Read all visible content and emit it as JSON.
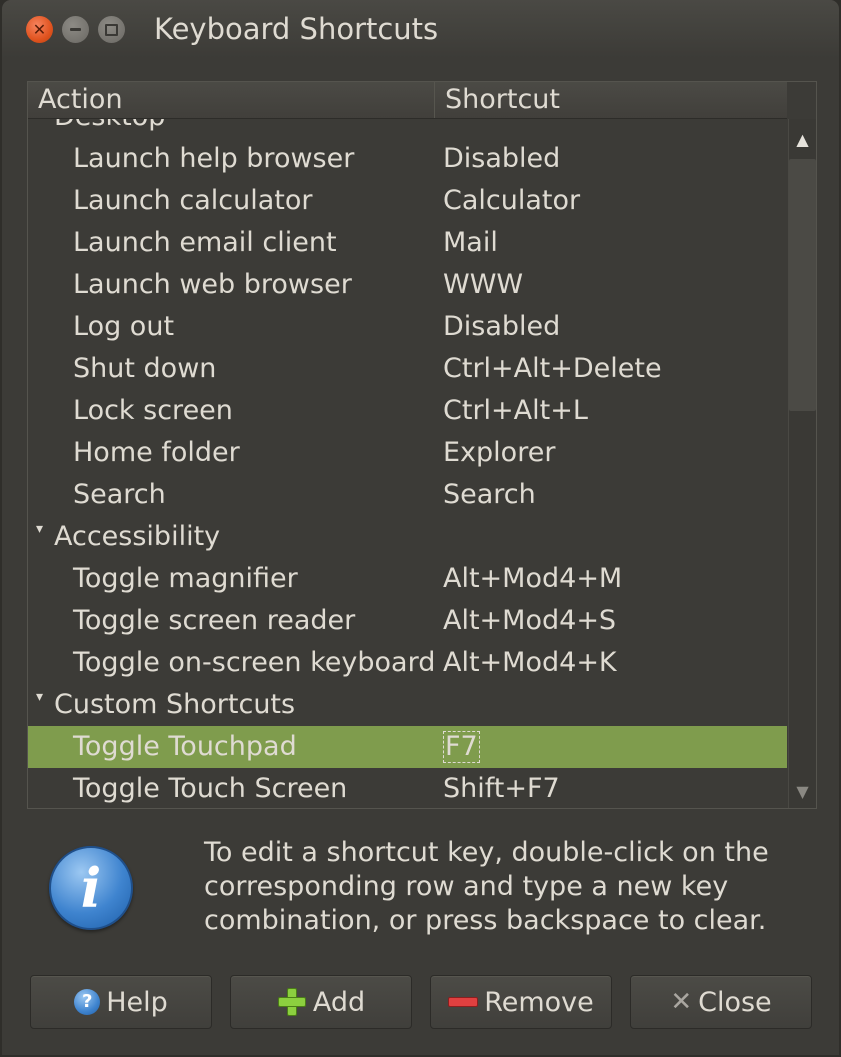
{
  "window": {
    "title": "Keyboard Shortcuts"
  },
  "columns": {
    "action": "Action",
    "shortcut": "Shortcut"
  },
  "rows": [
    {
      "type": "category",
      "action": "Desktop",
      "shortcut": ""
    },
    {
      "type": "item",
      "action": "Launch help browser",
      "shortcut": "Disabled"
    },
    {
      "type": "item",
      "action": "Launch calculator",
      "shortcut": "Calculator"
    },
    {
      "type": "item",
      "action": "Launch email client",
      "shortcut": "Mail"
    },
    {
      "type": "item",
      "action": "Launch web browser",
      "shortcut": "WWW"
    },
    {
      "type": "item",
      "action": "Log out",
      "shortcut": "Disabled"
    },
    {
      "type": "item",
      "action": "Shut down",
      "shortcut": "Ctrl+Alt+Delete"
    },
    {
      "type": "item",
      "action": "Lock screen",
      "shortcut": "Ctrl+Alt+L"
    },
    {
      "type": "item",
      "action": "Home folder",
      "shortcut": "Explorer"
    },
    {
      "type": "item",
      "action": "Search",
      "shortcut": "Search"
    },
    {
      "type": "category",
      "action": "Accessibility",
      "shortcut": ""
    },
    {
      "type": "item",
      "action": "Toggle magnifier",
      "shortcut": "Alt+Mod4+M"
    },
    {
      "type": "item",
      "action": "Toggle screen reader",
      "shortcut": "Alt+Mod4+S"
    },
    {
      "type": "item",
      "action": "Toggle on-screen keyboard",
      "shortcut": "Alt+Mod4+K"
    },
    {
      "type": "category",
      "action": "Custom Shortcuts",
      "shortcut": ""
    },
    {
      "type": "item",
      "action": "Toggle Touchpad",
      "shortcut": "F7",
      "selected": true
    },
    {
      "type": "item",
      "action": "Toggle Touch Screen",
      "shortcut": "Shift+F7"
    }
  ],
  "info": {
    "icon": "info-icon",
    "text": "To edit a shortcut key, double-click on the corresponding row and type a new key combination, or press backspace to clear."
  },
  "buttons": {
    "help": "Help",
    "add": "Add",
    "remove": "Remove",
    "close": "Close"
  },
  "colors": {
    "selection": "#7f9c4d",
    "window_bg": "#3c3b37",
    "text": "#dfdbd2"
  }
}
